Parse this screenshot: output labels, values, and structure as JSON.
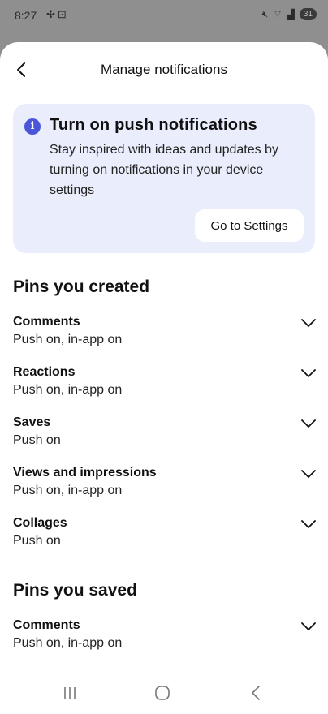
{
  "status_bar": {
    "time": "8:27",
    "left_icons": [
      "pinwheel-icon",
      "screenshot-icon"
    ],
    "right_icons": [
      "mute-icon",
      "wifi-icon",
      "signal-icon"
    ],
    "battery": "31"
  },
  "header": {
    "title": "Manage notifications"
  },
  "banner": {
    "title": "Turn on push notifications",
    "body": "Stay inspired with ideas and updates by turning on notifications in your device settings",
    "button_label": "Go to Settings",
    "background": "#eaedfb",
    "icon_color": "#4a55d8"
  },
  "sections": [
    {
      "title": "Pins you created",
      "items": [
        {
          "title": "Comments",
          "subtitle": "Push on, in-app on"
        },
        {
          "title": "Reactions",
          "subtitle": "Push on, in-app on"
        },
        {
          "title": "Saves",
          "subtitle": "Push on"
        },
        {
          "title": "Views and impressions",
          "subtitle": "Push on, in-app on"
        },
        {
          "title": "Collages",
          "subtitle": "Push on"
        }
      ]
    },
    {
      "title": "Pins you saved",
      "items": [
        {
          "title": "Comments",
          "subtitle": "Push on, in-app on"
        }
      ]
    }
  ]
}
